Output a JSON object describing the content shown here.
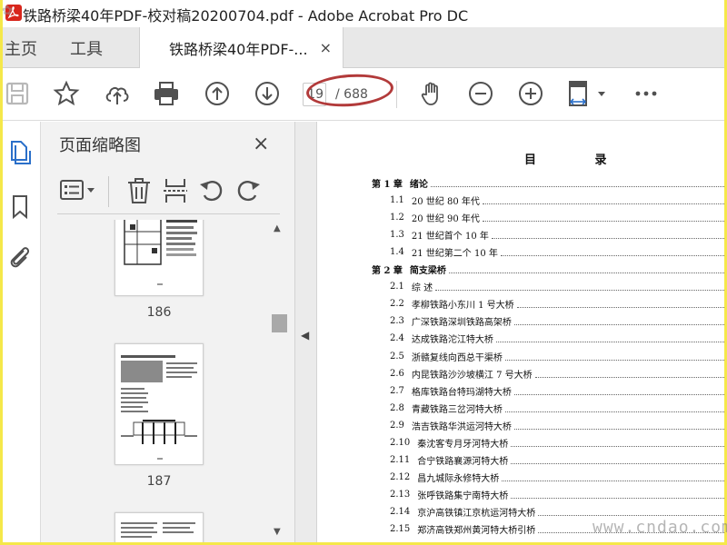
{
  "window": {
    "title": "铁路桥梁40年PDF-校对稿20200704.pdf - Adobe Acrobat Pro DC"
  },
  "tabs": {
    "home": "主页",
    "tools": "工具",
    "doc": "铁路桥梁40年PDF-...",
    "close": "×"
  },
  "toolbar": {
    "page_current": "19",
    "page_total": "/ 688"
  },
  "thumbnail_panel": {
    "title": "页面缩略图",
    "close": "×",
    "thumbs": [
      {
        "label": "186"
      },
      {
        "label": "187"
      }
    ]
  },
  "document": {
    "heading": "目 录",
    "toc": [
      {
        "num": "第 1 章",
        "title": "绪论",
        "type": "chapter"
      },
      {
        "num": "1.1",
        "title": "20 世纪 80 年代",
        "type": "section"
      },
      {
        "num": "1.2",
        "title": "20 世纪 90 年代",
        "type": "section"
      },
      {
        "num": "1.3",
        "title": "21 世纪首个 10 年",
        "type": "section"
      },
      {
        "num": "1.4",
        "title": "21 世纪第二个 10 年",
        "type": "section"
      },
      {
        "num": "第 2 章",
        "title": "简支梁桥",
        "type": "chapter"
      },
      {
        "num": "2.1",
        "title": "综 述",
        "type": "section"
      },
      {
        "num": "2.2",
        "title": "孝柳铁路小东川 1 号大桥",
        "type": "section"
      },
      {
        "num": "2.3",
        "title": "广深铁路深圳铁路高架桥",
        "type": "section"
      },
      {
        "num": "2.4",
        "title": "达成铁路沱江特大桥",
        "type": "section"
      },
      {
        "num": "2.5",
        "title": "浙赣复线向西总干渠桥",
        "type": "section"
      },
      {
        "num": "2.6",
        "title": "内昆铁路沙沙坡横江 7 号大桥",
        "type": "section"
      },
      {
        "num": "2.7",
        "title": "格库铁路台特玛湖特大桥",
        "type": "section"
      },
      {
        "num": "2.8",
        "title": "青藏铁路三岔河特大桥",
        "type": "section"
      },
      {
        "num": "2.9",
        "title": "浩吉铁路华洪运河特大桥",
        "type": "section"
      },
      {
        "num": "2.10",
        "title": "秦沈客专月牙河特大桥",
        "type": "section"
      },
      {
        "num": "2.11",
        "title": "合宁铁路襄源河特大桥",
        "type": "section"
      },
      {
        "num": "2.12",
        "title": "昌九城际永修特大桥",
        "type": "section"
      },
      {
        "num": "2.13",
        "title": "张呼铁路集宁南特大桥",
        "type": "section"
      },
      {
        "num": "2.14",
        "title": "京沪高铁镇江京杭运河特大桥",
        "type": "section"
      },
      {
        "num": "2.15",
        "title": "郑济高铁郑州黄河特大桥引桥",
        "type": "section"
      }
    ]
  },
  "watermarks": {
    "bottom_right": "www.cndao.com"
  }
}
